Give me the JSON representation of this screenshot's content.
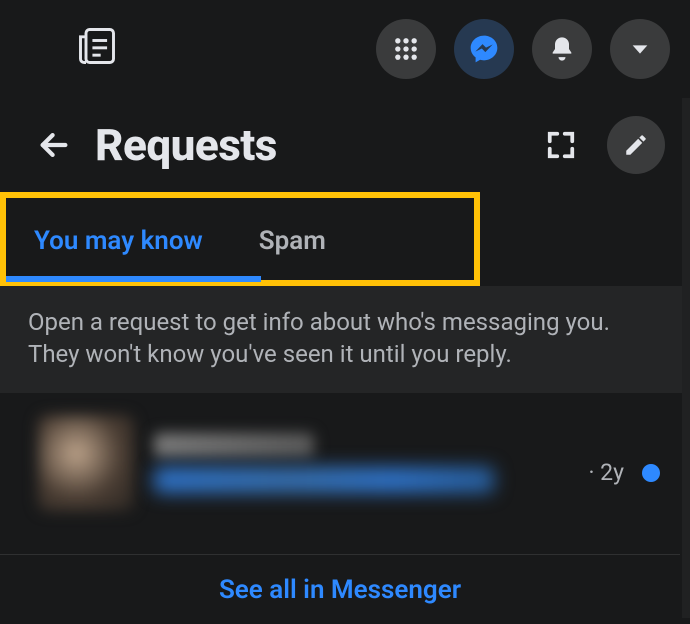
{
  "header": {
    "title": "Requests"
  },
  "tabs": {
    "you_may_know": "You may know",
    "spam": "Spam",
    "active": "you_may_know"
  },
  "info_text": "Open a request to get info about who's messaging you. They won't know you've seen it until you reply.",
  "request": {
    "timestamp": "· 2y"
  },
  "footer": {
    "see_all": "See all in Messenger"
  }
}
